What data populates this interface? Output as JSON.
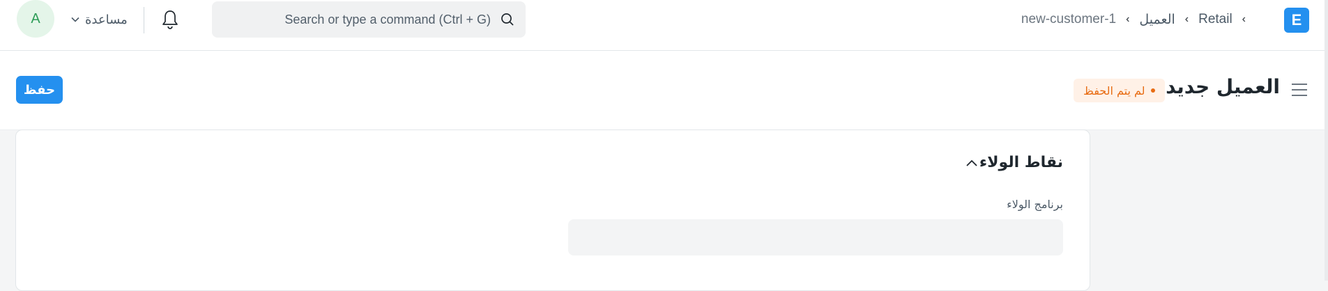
{
  "navbar": {
    "avatar_initial": "A",
    "help_label": "مساعدة",
    "search_placeholder": "Search or type a command (Ctrl + G)",
    "breadcrumbs": [
      {
        "label": "Retail"
      },
      {
        "label": "العميل"
      },
      {
        "label": "new-customer-1"
      }
    ],
    "app_logo": "E"
  },
  "page_header": {
    "title": "العميل جديد",
    "status": "لم يتم الحفظ",
    "save_label": "حفظ"
  },
  "section": {
    "title": "نقاط الولاء",
    "field_label": "برنامج الولاء",
    "field_value": ""
  },
  "colors": {
    "primary": "#2490ef",
    "status_orange": "#e86c13",
    "status_bg": "#fff1e7",
    "avatar_bg": "#e4f5e9",
    "avatar_text": "#2f9d58"
  },
  "icons": [
    "bell-icon",
    "search-icon",
    "chevron-down-icon",
    "chevron-up-icon",
    "menu-icon"
  ]
}
